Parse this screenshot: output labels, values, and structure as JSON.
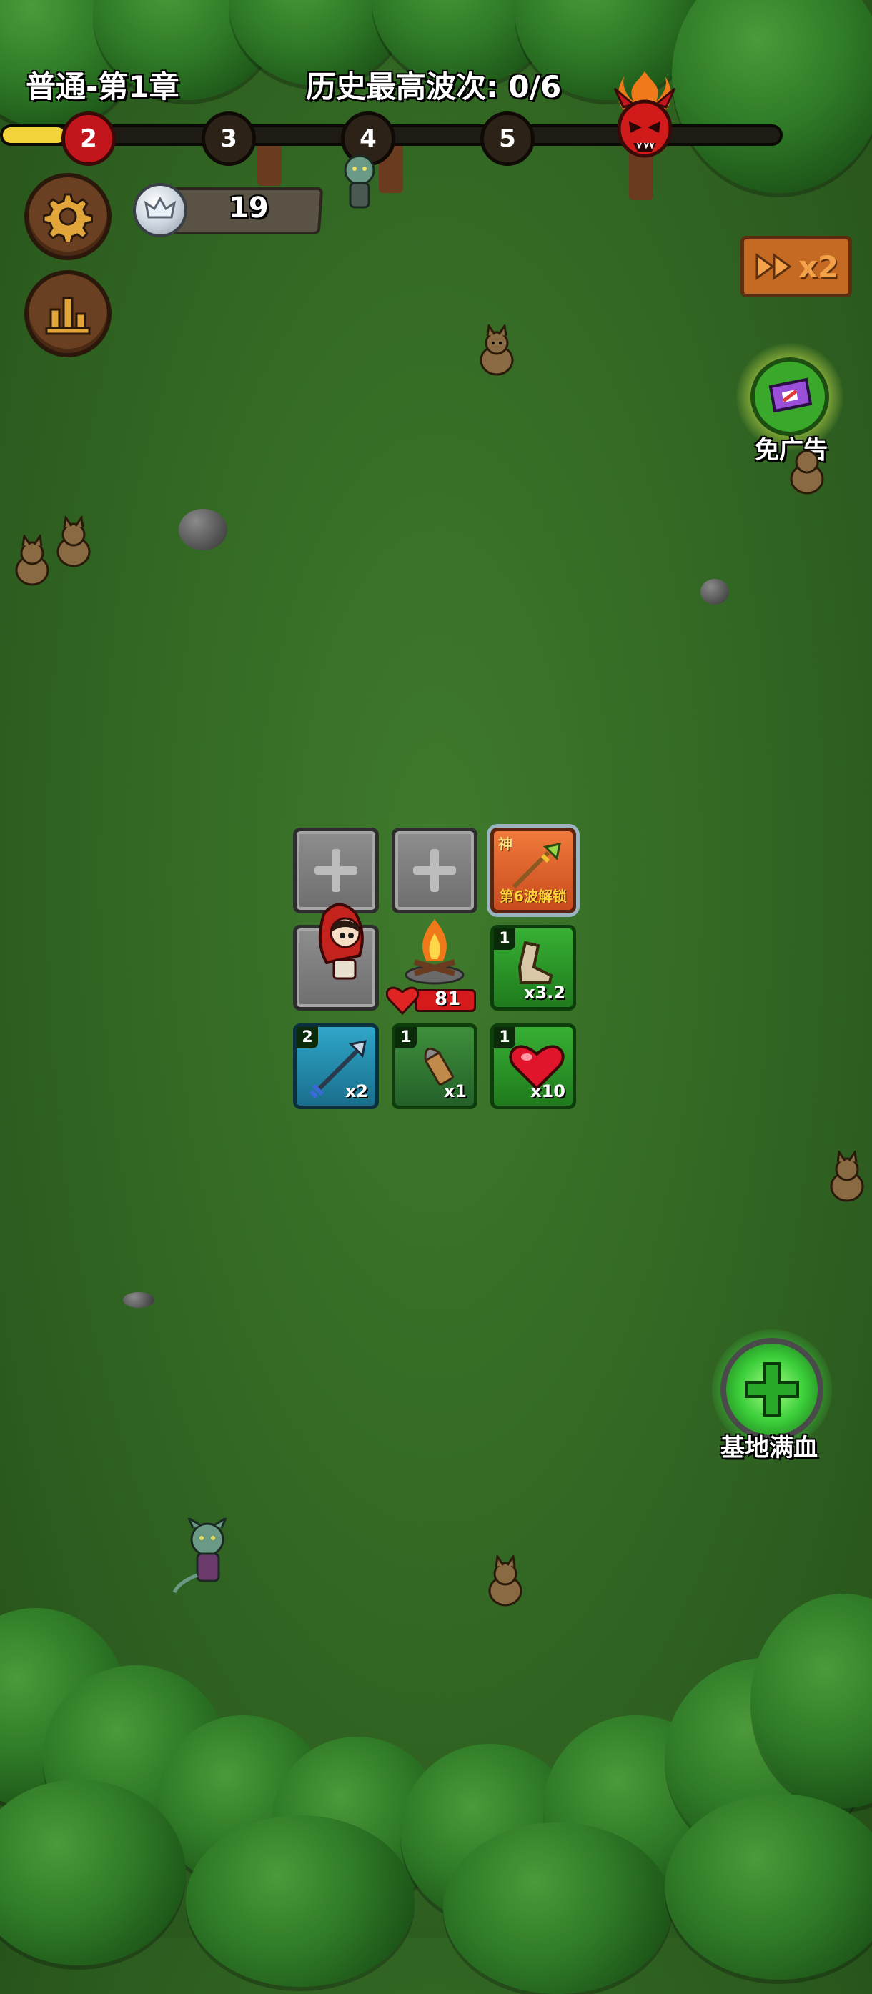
{
  "header": {
    "chapter": "普通-第1章",
    "best_wave": "历史最高波次: 0/6"
  },
  "wave_track": {
    "nodes": [
      "2",
      "3",
      "4",
      "5"
    ],
    "current": 2,
    "boss_icon": "demon-skull-icon",
    "progress_fraction": 0.08
  },
  "currency": {
    "icon": "crown-coin-icon",
    "amount": "19"
  },
  "speed_button": {
    "label": "x2",
    "icon": "fast-forward-icon"
  },
  "ad_free": {
    "label": "免广告",
    "icon": "ticket-icon"
  },
  "heal_button": {
    "label": "基地满血",
    "icon": "green-cross-icon"
  },
  "base": {
    "hp": "81",
    "icon": "campfire-icon"
  },
  "slots": {
    "locked": {
      "badge": "神",
      "label": "第6波解锁",
      "icon": "golden-spear-icon"
    },
    "boot": {
      "level": "1",
      "mult": "x3.2",
      "icon": "boot-icon"
    },
    "arrow": {
      "level": "2",
      "mult": "x2",
      "icon": "arrow-icon"
    },
    "bullet": {
      "level": "1",
      "mult": "x1",
      "icon": "bullet-icon"
    },
    "heart": {
      "level": "1",
      "mult": "x10",
      "icon": "heart-icon"
    }
  },
  "colors": {
    "grass": "#356b25",
    "wave_active": "#c3151c",
    "progress": "#f2d43a"
  }
}
